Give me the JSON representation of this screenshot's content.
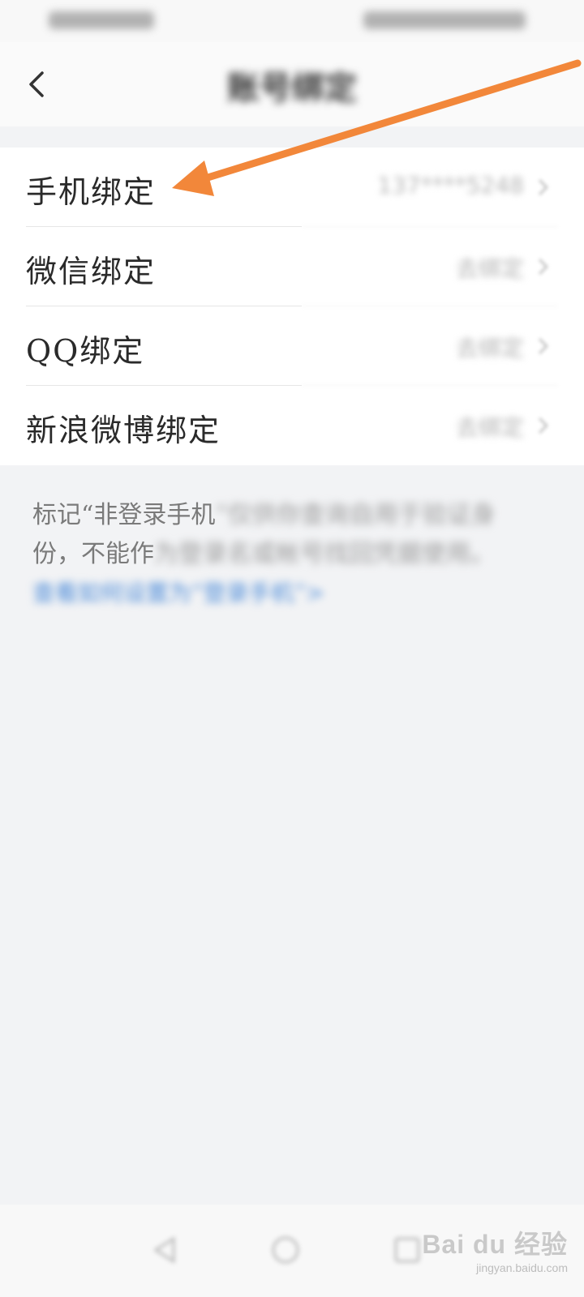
{
  "header": {
    "title": "账号绑定"
  },
  "list": {
    "items": [
      {
        "label": "手机绑定",
        "value": "137****5248"
      },
      {
        "label": "微信绑定",
        "value": "去绑定"
      },
      {
        "label": "QQ绑定",
        "value": "去绑定"
      },
      {
        "label": "新浪微博绑定",
        "value": "去绑定"
      }
    ]
  },
  "note": {
    "line1_clear": "标记“非登录手机",
    "line1_blur": "”仅供你查询自用于验证身",
    "line2_clear": "份，不能作",
    "line2_blur": "为登录名或帐号找回凭据使用。",
    "link": "查看如何设置为“登录手机”>"
  },
  "watermark": {
    "brand": "Bai du 经验",
    "url": "jingyan.baidu.com"
  },
  "colors": {
    "annotation_arrow": "#f2873a",
    "link": "#4a8ad8",
    "page_bg": "#f2f3f5"
  },
  "icons": {
    "back": "chevron-left-icon",
    "row_arrow": "chevron-right-icon",
    "nav_back": "triangle-back-icon",
    "nav_home": "circle-home-icon",
    "nav_recent": "square-recent-icon"
  }
}
